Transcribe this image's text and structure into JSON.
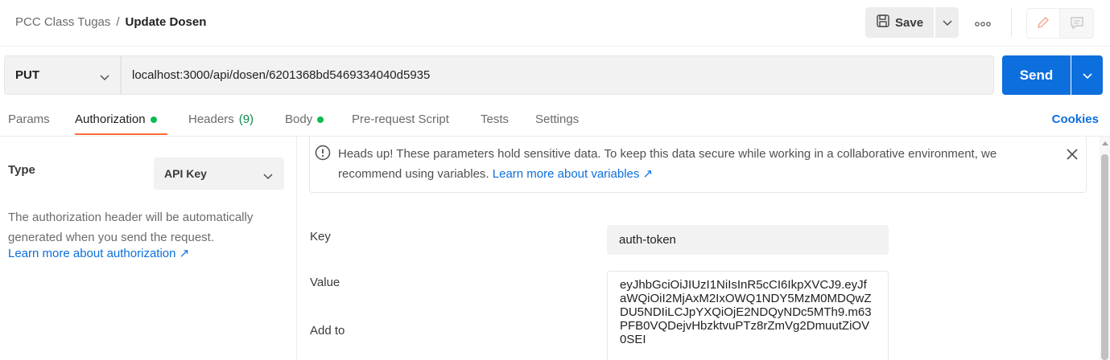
{
  "header": {
    "breadcrumb_parent": "PCC Class Tugas",
    "breadcrumb_separator": "/",
    "breadcrumb_current": "Update Dosen",
    "save_label": "Save",
    "more_icon": "ooo"
  },
  "request": {
    "method": "PUT",
    "url": "localhost:3000/api/dosen/6201368bd5469334040d5935",
    "send_label": "Send"
  },
  "tabs": [
    {
      "label": "Params"
    },
    {
      "label": "Authorization",
      "active": true,
      "dot": true
    },
    {
      "label": "Headers",
      "count": "(9)"
    },
    {
      "label": "Body",
      "dot": true
    },
    {
      "label": "Pre-request Script"
    },
    {
      "label": "Tests"
    },
    {
      "label": "Settings"
    }
  ],
  "cookies_label": "Cookies",
  "auth": {
    "type_label": "Type",
    "type_value": "API Key",
    "description": "The authorization header will be automatically generated when you send the request.",
    "learn_more": "Learn more about authorization ↗"
  },
  "alert": {
    "text": "Heads up! These parameters hold sensitive data. To keep this data secure while working in a collaborative environment, we recommend using variables. ",
    "link": "Learn more about variables ↗"
  },
  "fields": {
    "key_label": "Key",
    "key_value": "auth-token",
    "value_label": "Value",
    "value_lines": [
      "eyJhbGciOiJIUzI1NiIsInR5cCI6IkpXVCJ9.eyJf",
      "aWQiOiI2MjAxM2IxOWQ1NDY5MzM0MDQwZ",
      "DU5NDIiLCJpYXQiOjE2NDQyNDc5MTh9.m63",
      "PFB0VQDejvHbzktvuPTz8rZmVg2DmuutZiOV",
      "0SEI"
    ],
    "add_to_label": "Add to"
  },
  "colors": {
    "accent_blue": "#0c6fdd",
    "tab_underline": "#ff6c37",
    "status_dot": "#0cbb52"
  }
}
